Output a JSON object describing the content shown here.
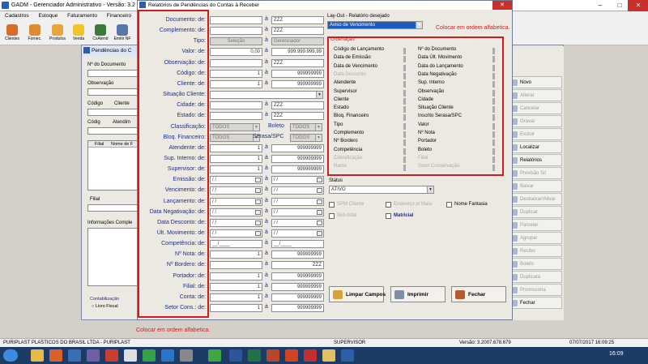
{
  "app": {
    "title": "GADM - Gerenciador Administrativo - Versão: 3.2",
    "window_controls": [
      "–",
      "□",
      "✕"
    ],
    "menu": [
      "Cadastros",
      "Estoque",
      "Faturamento",
      "Financeiro"
    ],
    "toolbar": [
      "Clientes",
      "Fornec.",
      "Produtos",
      "Venda",
      "CxAtend",
      "Emitir NF"
    ]
  },
  "bg_window": {
    "title": "Pendências do C",
    "close": "✕",
    "labels": {
      "num_doc": "Nº do Documento",
      "obs": "Observação",
      "cod1": "Código",
      "cliente": "Cliente",
      "cod2": "Códig",
      "atend": "Atendim",
      "filial_col": "Filial",
      "nome_col": "Nome de F",
      "filial": "Filial",
      "info": "Informações Comple",
      "contab": "Contabilização",
      "livro": "Livro Fiscal"
    }
  },
  "right_panel": {
    "buttons": [
      {
        "label": "Novo",
        "enabled": true
      },
      {
        "label": "Alterar",
        "enabled": false
      },
      {
        "label": "Cancelar",
        "enabled": false
      },
      {
        "label": "Gravar",
        "enabled": false
      },
      {
        "label": "Excluir",
        "enabled": false
      },
      {
        "label": "Localizar",
        "enabled": true
      },
      {
        "label": "Relatórios",
        "enabled": true
      },
      {
        "label": "Previsão Sit",
        "enabled": false
      },
      {
        "label": "Baixar",
        "enabled": false
      },
      {
        "label": "Desbaixar/Ativar",
        "enabled": false
      },
      {
        "label": "Duplicar",
        "enabled": false
      },
      {
        "label": "Parcelar",
        "enabled": false
      },
      {
        "label": "Agrupar",
        "enabled": false
      },
      {
        "label": "Recibo",
        "enabled": false
      },
      {
        "label": "Boleto",
        "enabled": false
      },
      {
        "label": "Duplicata",
        "enabled": false
      },
      {
        "label": "Promissória",
        "enabled": false
      },
      {
        "label": "Fechar",
        "enabled": true
      }
    ]
  },
  "modal": {
    "title": "Relatórios de Pendências do Contas à Receber",
    "close": "✕",
    "ate": "à",
    "fields": [
      {
        "label": "Documento:  de:",
        "from": "",
        "to": "ZZZ"
      },
      {
        "label": "Complemento:  de:",
        "from": "",
        "to": "ZZZ"
      },
      {
        "label": "Tipo:",
        "from": "Seleção",
        "to": "Gerenciador"
      },
      {
        "label": "Valor:  de:",
        "from": "0,00",
        "to": "999.999.999,99"
      },
      {
        "label": "Observação:  de:",
        "from": "",
        "to": "ZZZ"
      },
      {
        "label": "Código:  de:",
        "from": "1",
        "to": "999999999"
      },
      {
        "label": "Cliente:  de:",
        "from": "1",
        "to": "999999999"
      },
      {
        "label": "Situação Cliente:",
        "from": "",
        "to": ""
      },
      {
        "label": "Cidade:  de:",
        "from": "",
        "to": "ZZZ"
      },
      {
        "label": "Estado:  de:",
        "from": "",
        "to": "ZZZ"
      },
      {
        "label": "Classificação:",
        "from": "TODOS",
        "to": "TODOS"
      },
      {
        "label": "Bloq. Financeiro:",
        "from": "TODOS",
        "to": "TODOS"
      },
      {
        "label": "Atendente:  de:",
        "from": "1",
        "to": "999999999"
      },
      {
        "label": "Sup. Interno:  de:",
        "from": "1",
        "to": "999999999"
      },
      {
        "label": "Supervisor:  de:",
        "from": "1",
        "to": "999999999"
      },
      {
        "label": "Emissão:  de:",
        "from": "/  /",
        "to": "/  /"
      },
      {
        "label": "Vencimento:  de:",
        "from": "/  /",
        "to": "/  /"
      },
      {
        "label": "Lançamento:  de:",
        "from": "/  /",
        "to": "/  /"
      },
      {
        "label": "Data Negativação:  de:",
        "from": "/  /",
        "to": "/  /"
      },
      {
        "label": "Data Desconto:  de:",
        "from": "/  /",
        "to": "/  /"
      },
      {
        "label": "Últ. Movimento:  de:",
        "from": "/  /",
        "to": "/  /"
      },
      {
        "label": "Competência:  de:",
        "from": "__/____",
        "to": "__/____"
      },
      {
        "label": "Nº Nota:  de:",
        "from": "1",
        "to": "999999999"
      },
      {
        "label": "Nº Bordero:  de:",
        "from": "",
        "to": "ZZZ"
      },
      {
        "label": "Portador:  de:",
        "from": "1",
        "to": "999999999"
      },
      {
        "label": "Filial:  de:",
        "from": "1",
        "to": "999999999"
      },
      {
        "label": "Conta:  de:",
        "from": "1",
        "to": "999999999"
      },
      {
        "label": "Setor Cons.:  de:",
        "from": "1",
        "to": "999999999"
      }
    ],
    "boleto_label": "Boleto",
    "serasa_label": "Serasa/SPC",
    "layout": {
      "label": "Lay-Out - Relatório desejado",
      "value": "Aviso de Vencimento"
    },
    "ordenacao": {
      "title": "Ordenação",
      "left": [
        {
          "label": "Código de Lançamento",
          "enabled": true
        },
        {
          "label": "Data de Emissão",
          "enabled": true
        },
        {
          "label": "Data de Vencimento",
          "enabled": true
        },
        {
          "label": "Data Desconto",
          "enabled": false
        },
        {
          "label": "Atendente",
          "enabled": true
        },
        {
          "label": "Supervisor",
          "enabled": true
        },
        {
          "label": "Cliente",
          "enabled": true
        },
        {
          "label": "Estado",
          "enabled": true
        },
        {
          "label": "Bloq. Financeiro",
          "enabled": true
        },
        {
          "label": "Tipo",
          "enabled": true
        },
        {
          "label": "Complemento",
          "enabled": true
        },
        {
          "label": "Nº Bordero",
          "enabled": true
        },
        {
          "label": "Competência",
          "enabled": true
        },
        {
          "label": "Classificação",
          "enabled": false
        },
        {
          "label": "Ramo",
          "enabled": false
        }
      ],
      "right": [
        {
          "label": "Nº do Documento",
          "enabled": true
        },
        {
          "label": "Data Últ. Movimento",
          "enabled": true
        },
        {
          "label": "Data do Lançamento",
          "enabled": true
        },
        {
          "label": "Data Negativação",
          "enabled": true
        },
        {
          "label": "Sup. Interno",
          "enabled": true
        },
        {
          "label": "Observação",
          "enabled": true
        },
        {
          "label": "Cidade",
          "enabled": true
        },
        {
          "label": "Situação Cliente",
          "enabled": true
        },
        {
          "label": "Inscrito Serasa/SPC",
          "enabled": true
        },
        {
          "label": "Valor",
          "enabled": true
        },
        {
          "label": "Nº Nota",
          "enabled": true
        },
        {
          "label": "Portador",
          "enabled": true
        },
        {
          "label": "Boleto",
          "enabled": true
        },
        {
          "label": "Filial",
          "enabled": false
        },
        {
          "label": "Setor Conservação",
          "enabled": false
        }
      ]
    },
    "status": {
      "label": "Status",
      "value": "ATIVO"
    },
    "checks": [
      {
        "label": "SPM Cliente",
        "enabled": false
      },
      {
        "label": "Endereço p/ Mala",
        "enabled": false
      },
      {
        "label": "Nome Fantasia",
        "enabled": true
      },
      {
        "label": "Sub-total",
        "enabled": false
      },
      {
        "label": "Matricial",
        "enabled": true
      }
    ],
    "buttons": {
      "clear": "Limpar Campos",
      "print": "Imprimir",
      "close": "Fechar"
    }
  },
  "annotations": {
    "top": "Colocar em ordem alfabetica.",
    "bottom": "Colocar em ordem alfabetica."
  },
  "statusbar": {
    "company": "PURIPLAST PLASTICOS DO BRASIL LTDA  -  PURIPLAST",
    "user": "SUPERVISOR",
    "version": "Versão: 3.2007.678.679",
    "datetime": "07/07/2017 16:09:25"
  },
  "taskbar": {
    "clock": "16:09"
  },
  "colors": {
    "label_blue": "#1b2f8c",
    "annotation_red": "#d21c1c",
    "titlebar_blue": "#2d5ea8"
  }
}
